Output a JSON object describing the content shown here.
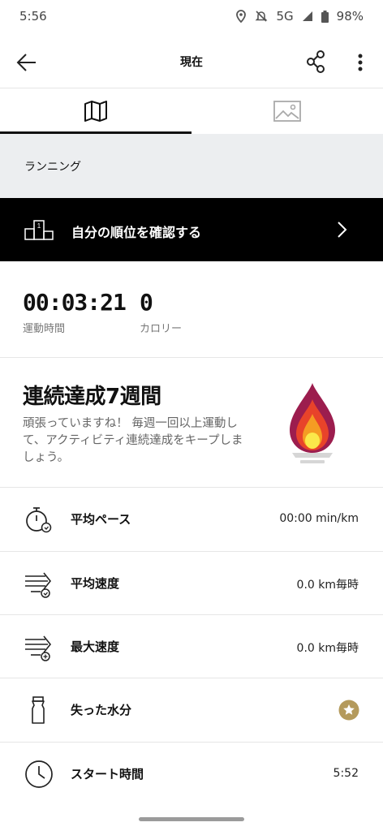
{
  "status_bar": {
    "time": "5:56",
    "network": "5G",
    "battery": "98%"
  },
  "app_bar": {
    "title": "現在"
  },
  "tabs": [
    {
      "icon": "map-icon"
    },
    {
      "icon": "image-icon"
    }
  ],
  "activity_type": "ランニング",
  "ranking": {
    "label": "自分の順位を確認する"
  },
  "stats": {
    "duration": {
      "value": "00:03:21",
      "label": "運動時間"
    },
    "calories": {
      "value": "0",
      "label": "カロリー"
    }
  },
  "streak": {
    "title": "連続達成7週間",
    "description": "頑張っていますね！ 毎週一回以上運動して、アクティビティ連続達成をキープしましょう。",
    "colors": {
      "outer": "#9c1d4e",
      "middle": "#e8432a",
      "inner": "#f59c23",
      "core": "#fbe84a"
    }
  },
  "metrics": [
    {
      "label": "平均ペース",
      "value": "00:00 min/km",
      "icon": "stopwatch-icon"
    },
    {
      "label": "平均速度",
      "value": "0.0 km毎時",
      "icon": "average-speed-icon"
    },
    {
      "label": "最大速度",
      "value": "0.0 km毎時",
      "icon": "max-speed-icon"
    },
    {
      "label": "失った水分",
      "value": "",
      "icon": "water-bottle-icon",
      "badge": "premium-star-icon",
      "badge_color": "#b49a5c"
    },
    {
      "label": "スタート時間",
      "value": "5:52",
      "icon": "clock-icon"
    }
  ]
}
